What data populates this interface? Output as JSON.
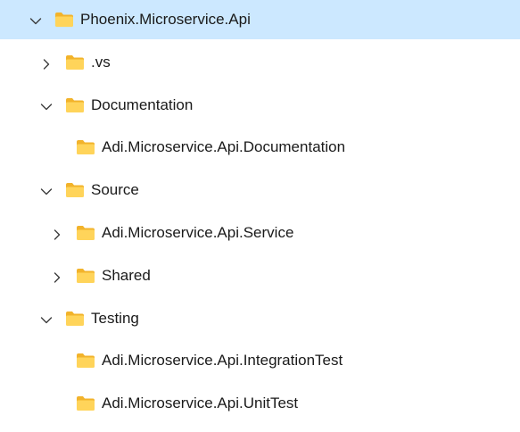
{
  "colors": {
    "selected_row": "#cce8ff",
    "folder_body": "#ffd45a",
    "folder_tab": "#f2b32b",
    "chevron": "#3b3b3b",
    "text": "#1a1a1a"
  },
  "icons": {
    "folder": "folder-icon",
    "expanded": "chevron-down-icon",
    "collapsed": "chevron-right-icon"
  },
  "tree": [
    {
      "label": "Phoenix.Microservice.Api",
      "depth": 0,
      "state": "expanded",
      "selected": true
    },
    {
      "label": ".vs",
      "depth": 1,
      "state": "collapsed",
      "selected": false
    },
    {
      "label": "Documentation",
      "depth": 1,
      "state": "expanded",
      "selected": false
    },
    {
      "label": "Adi.Microservice.Api.Documentation",
      "depth": 2,
      "state": "leaf",
      "selected": false
    },
    {
      "label": "Source",
      "depth": 1,
      "state": "expanded",
      "selected": false
    },
    {
      "label": "Adi.Microservice.Api.Service",
      "depth": 2,
      "state": "collapsed",
      "selected": false
    },
    {
      "label": "Shared",
      "depth": 2,
      "state": "collapsed",
      "selected": false
    },
    {
      "label": "Testing",
      "depth": 1,
      "state": "expanded",
      "selected": false
    },
    {
      "label": "Adi.Microservice.Api.IntegrationTest",
      "depth": 2,
      "state": "leaf",
      "selected": false
    },
    {
      "label": "Adi.Microservice.Api.UnitTest",
      "depth": 2,
      "state": "leaf",
      "selected": false
    }
  ]
}
